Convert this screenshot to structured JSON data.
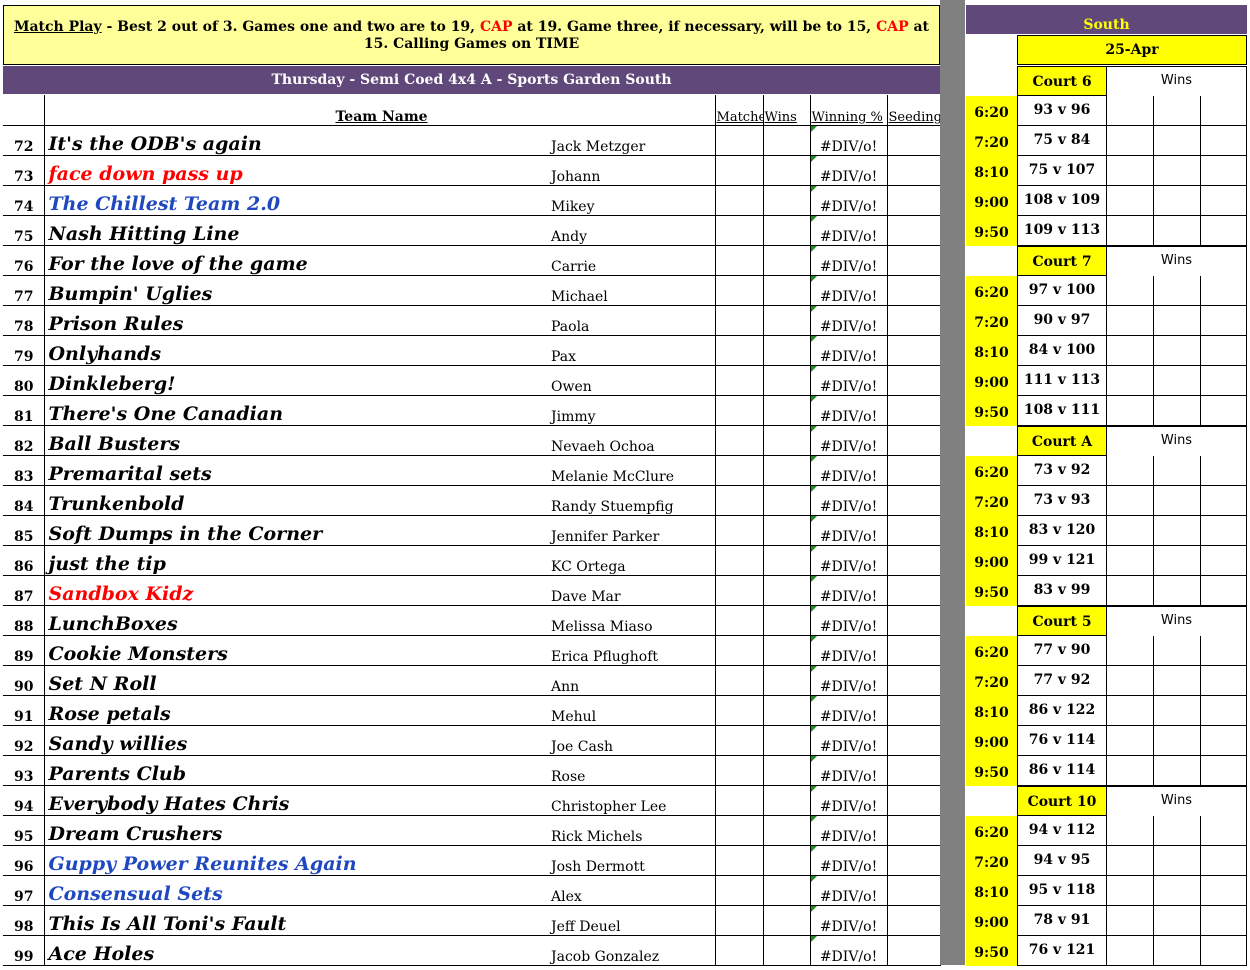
{
  "notice": {
    "lead": "Match Play",
    "part1": " - Best 2 out of 3.  Games one and two are to 19, ",
    "cap1": "CAP",
    "part2": " at 19.  Game three, if necessary, will be to 15, ",
    "cap2": "CAP",
    "part3": " at 15. Calling Games on TIME"
  },
  "league_title": "Thursday - Semi Coed 4x4 A - Sports Garden South",
  "headers": {
    "team": "Team Name",
    "matches": "Matches",
    "wins": "Wins",
    "pct": "Winning %",
    "seeding": "Seeding"
  },
  "teams": [
    {
      "num": "72",
      "name": "It's the ODB's again",
      "captain": "Jack Metzger",
      "pct": "#DIV/o!",
      "color": "black"
    },
    {
      "num": "73",
      "name": "face down pass up",
      "captain": "Johann",
      "pct": "#DIV/o!",
      "color": "red"
    },
    {
      "num": "74",
      "name": "The Chillest Team 2.0",
      "captain": "Mikey",
      "pct": "#DIV/o!",
      "color": "blue"
    },
    {
      "num": "75",
      "name": "Nash Hitting Line",
      "captain": "Andy",
      "pct": "#DIV/o!",
      "color": "black"
    },
    {
      "num": "76",
      "name": "For the love of the game",
      "captain": "Carrie",
      "pct": "#DIV/o!",
      "color": "black"
    },
    {
      "num": "77",
      "name": "Bumpin' Uglies",
      "captain": "Michael",
      "pct": "#DIV/o!",
      "color": "black"
    },
    {
      "num": "78",
      "name": "Prison Rules",
      "captain": "Paola",
      "pct": "#DIV/o!",
      "color": "black"
    },
    {
      "num": "79",
      "name": "Onlyhands",
      "captain": "Pax",
      "pct": "#DIV/o!",
      "color": "black"
    },
    {
      "num": "80",
      "name": "Dinkleberg!",
      "captain": "Owen",
      "pct": "#DIV/o!",
      "color": "black"
    },
    {
      "num": "81",
      "name": "There's One Canadian",
      "captain": "Jimmy",
      "pct": "#DIV/o!",
      "color": "black"
    },
    {
      "num": "82",
      "name": "Ball Busters",
      "captain": "Nevaeh Ochoa",
      "pct": "#DIV/o!",
      "color": "black"
    },
    {
      "num": "83",
      "name": "Premarital sets",
      "captain": "Melanie McClure",
      "pct": "#DIV/o!",
      "color": "black"
    },
    {
      "num": "84",
      "name": "Trunkenbold",
      "captain": "Randy Stuempfig",
      "pct": "#DIV/o!",
      "color": "black"
    },
    {
      "num": "85",
      "name": "Soft Dumps in the Corner",
      "captain": "Jennifer Parker",
      "pct": "#DIV/o!",
      "color": "black"
    },
    {
      "num": "86",
      "name": "just the tip",
      "captain": "KC Ortega",
      "pct": "#DIV/o!",
      "color": "black"
    },
    {
      "num": "87",
      "name": "Sandbox Kidz",
      "captain": "Dave Mar",
      "pct": "#DIV/o!",
      "color": "red"
    },
    {
      "num": "88",
      "name": "LunchBoxes",
      "captain": "Melissa Miaso",
      "pct": "#DIV/o!",
      "color": "black"
    },
    {
      "num": "89",
      "name": "Cookie Monsters",
      "captain": "Erica Pflughoft",
      "pct": "#DIV/o!",
      "color": "black"
    },
    {
      "num": "90",
      "name": "Set N Roll",
      "captain": "Ann",
      "pct": "#DIV/o!",
      "color": "black"
    },
    {
      "num": "91",
      "name": "Rose petals",
      "captain": "Mehul",
      "pct": "#DIV/o!",
      "color": "black"
    },
    {
      "num": "92",
      "name": "Sandy willies",
      "captain": "Joe Cash",
      "pct": "#DIV/o!",
      "color": "black"
    },
    {
      "num": "93",
      "name": "Parents Club",
      "captain": "Rose",
      "pct": "#DIV/o!",
      "color": "black"
    },
    {
      "num": "94",
      "name": "Everybody Hates Chris",
      "captain": "Christopher Lee",
      "pct": "#DIV/o!",
      "color": "black"
    },
    {
      "num": "95",
      "name": "Dream Crushers",
      "captain": "Rick Michels",
      "pct": "#DIV/o!",
      "color": "black"
    },
    {
      "num": "96",
      "name": "Guppy Power Reunites Again",
      "captain": "Josh Dermott",
      "pct": "#DIV/o!",
      "color": "blue"
    },
    {
      "num": "97",
      "name": "Consensual Sets",
      "captain": "Alex",
      "pct": "#DIV/o!",
      "color": "blue"
    },
    {
      "num": "98",
      "name": "This Is All Toni's Fault",
      "captain": "Jeff Deuel",
      "pct": "#DIV/o!",
      "color": "black"
    },
    {
      "num": "99",
      "name": "Ace Holes",
      "captain": "Jacob Gonzalez",
      "pct": "#DIV/o!",
      "color": "black"
    }
  ],
  "schedule": {
    "location": "South",
    "date": "25-Apr",
    "wins_label": "Wins",
    "courts": [
      {
        "name": "Court 6",
        "games": [
          {
            "time": "6:20",
            "match": "93 v 96"
          },
          {
            "time": "7:20",
            "match": "75 v 84"
          },
          {
            "time": "8:10",
            "match": "75 v 107"
          },
          {
            "time": "9:00",
            "match": "108 v 109"
          },
          {
            "time": "9:50",
            "match": "109 v 113"
          }
        ]
      },
      {
        "name": "Court 7",
        "games": [
          {
            "time": "6:20",
            "match": "97 v 100"
          },
          {
            "time": "7:20",
            "match": "90 v 97"
          },
          {
            "time": "8:10",
            "match": "84 v 100"
          },
          {
            "time": "9:00",
            "match": "111 v 113"
          },
          {
            "time": "9:50",
            "match": "108 v 111"
          }
        ]
      },
      {
        "name": "Court A",
        "games": [
          {
            "time": "6:20",
            "match": "73 v 92"
          },
          {
            "time": "7:20",
            "match": "73 v 93"
          },
          {
            "time": "8:10",
            "match": "83 v 120"
          },
          {
            "time": "9:00",
            "match": "99 v 121"
          },
          {
            "time": "9:50",
            "match": "83 v 99"
          }
        ]
      },
      {
        "name": "Court 5",
        "games": [
          {
            "time": "6:20",
            "match": "77 v 90"
          },
          {
            "time": "7:20",
            "match": "77 v 92"
          },
          {
            "time": "8:10",
            "match": "86 v 122"
          },
          {
            "time": "9:00",
            "match": "76 v 114"
          },
          {
            "time": "9:50",
            "match": "86 v 114"
          }
        ]
      },
      {
        "name": "Court 10",
        "games": [
          {
            "time": "6:20",
            "match": "94 v 112"
          },
          {
            "time": "7:20",
            "match": "94 v 95"
          },
          {
            "time": "8:10",
            "match": "95 v 118"
          },
          {
            "time": "9:00",
            "match": "78 v 91"
          },
          {
            "time": "9:50",
            "match": "76 v 121"
          }
        ]
      }
    ]
  },
  "colors": {
    "header_purple": "#60497a",
    "notice_yellow": "#ffff99",
    "cell_yellow": "#ffff00",
    "team_red": "#ff0000",
    "team_blue": "#1f48c0",
    "divider_grey": "#808080"
  }
}
